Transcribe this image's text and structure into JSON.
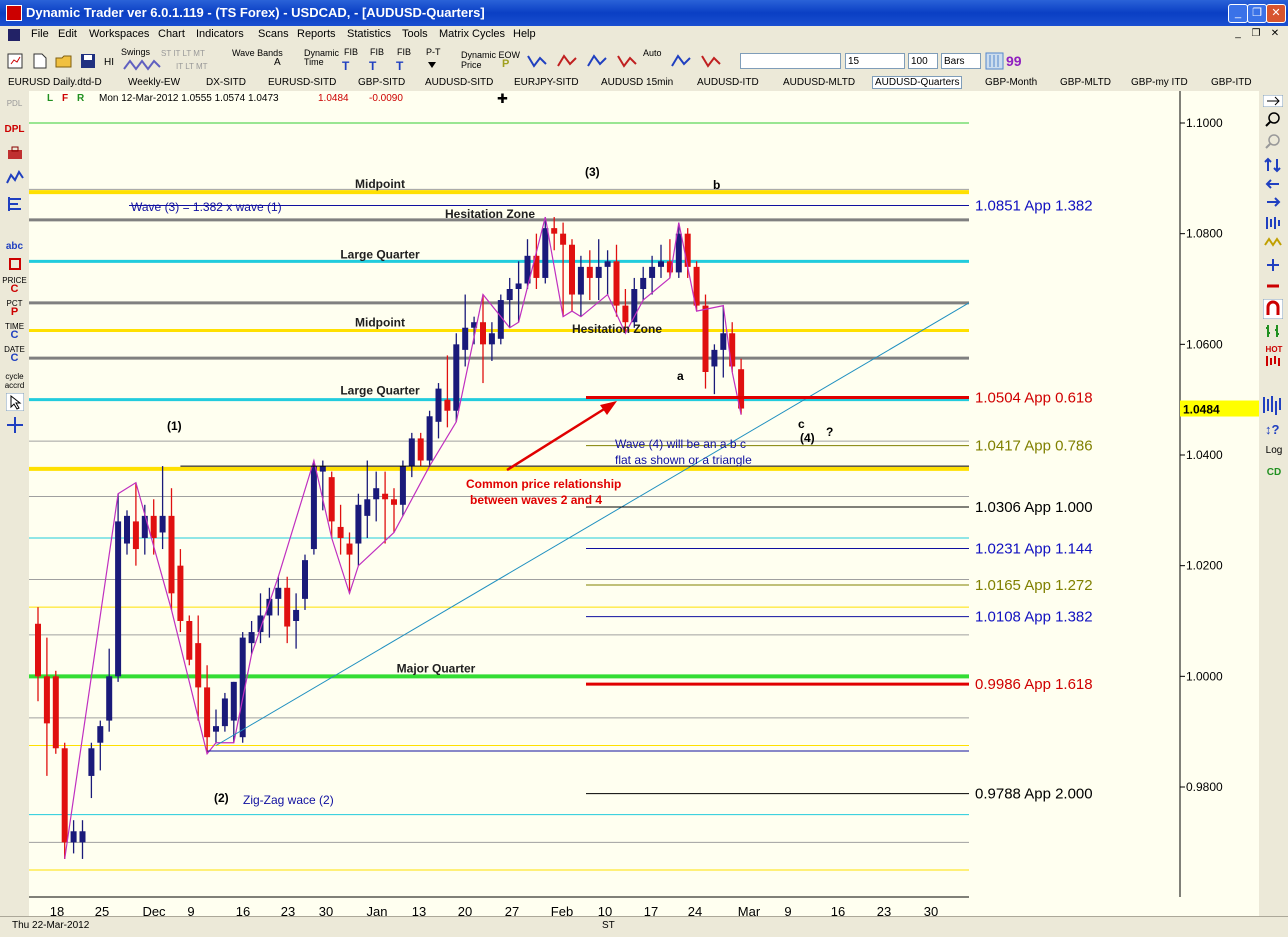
{
  "window": {
    "title": "Dynamic Trader ver 6.0.1.119 - (TS Forex) - USDCAD, - [AUDUSD-Quarters]",
    "minimize": "_",
    "restore": "❐",
    "close": "✕"
  },
  "menu": {
    "items": [
      "File",
      "Edit",
      "Workspaces",
      "Chart",
      "Indicators",
      "Scans",
      "Reports",
      "Statistics",
      "Tools",
      "Matrix Cycles",
      "Help"
    ],
    "mdi_min": "_",
    "mdi_restore": "❐",
    "mdi_close": "✕"
  },
  "toolbar": {
    "hi": "HI",
    "swings": "Swings",
    "swing_sub1": "ST IT LT MT",
    "swing_sub2": "IT LT MT",
    "wave_bands": "Wave Bands",
    "wave_a": "A",
    "dynamic_time": "Dynamic Time",
    "fib_t1": "FIB",
    "fib_t2": "FIB",
    "fib_t3": "FIB",
    "pt": "P-T",
    "dyn_eow": "Dynamic EOW",
    "dyn_price": "Price",
    "auto": "Auto",
    "combo_value": "15",
    "count_value": "100",
    "bars_value": "Bars"
  },
  "tabs": [
    "EURUSD  Daily.dtd-D",
    "Weekly-EW",
    "DX-SITD",
    "EURUSD-SITD",
    "GBP-SITD",
    "AUDUSD-SITD",
    "EURJPY-SITD",
    "AUDUSD  15min",
    "AUDUSD-ITD",
    "AUDUSD-MLTD",
    "AUDUSD-Quarters",
    "GBP-Month",
    "GBP-MLTD",
    "GBP-my ITD",
    "GBP-ITD"
  ],
  "active_tab": "AUDUSD-Quarters",
  "chart_header": {
    "pdl": "PDL",
    "flags": [
      "L",
      "F",
      "R"
    ],
    "ohlc": "Mon 12-Mar-2012   1.0555   1.0574   1.0473",
    "close": "1.0484",
    "change": "-0.0090",
    "crosshair": "✚"
  },
  "left_tools": [
    "DPL",
    "abc",
    "PRICE",
    "C",
    "PCT",
    "P",
    "TIME",
    "C",
    "DATE",
    "C",
    "cycle",
    "accrd"
  ],
  "right_tools": {
    "log": "Log",
    "cd": "CD",
    "hot": "HOT"
  },
  "status": {
    "date": "Thu 22-Mar-2012",
    "st": "ST"
  },
  "chart_data": {
    "type": "candlestick",
    "y_ticks": [
      "1.1000",
      "1.0800",
      "1.0600",
      "1.0400",
      "1.0200",
      "1.0000",
      "0.9800"
    ],
    "ylim": [
      0.965,
      1.105
    ],
    "last_price_label": "1.0484",
    "x_ticks": [
      "18",
      "25",
      "Dec",
      "9",
      "16",
      "23",
      "30",
      "Jan",
      "13",
      "20",
      "27",
      "Feb",
      "10",
      "17",
      "24",
      "Mar",
      "9",
      "16",
      "23",
      "30"
    ],
    "candles": [
      [
        1.0095,
        1.0125,
        0.9955,
        1.0
      ],
      [
        1.0,
        1.007,
        0.982,
        0.9915
      ],
      [
        1.0,
        1.001,
        0.986,
        0.987
      ],
      [
        0.987,
        0.988,
        0.967,
        0.97
      ],
      [
        0.97,
        0.974,
        0.968,
        0.972
      ],
      [
        0.97,
        0.974,
        0.967,
        0.972
      ],
      [
        0.982,
        0.988,
        0.978,
        0.987
      ],
      [
        0.988,
        0.992,
        0.983,
        0.991
      ],
      [
        0.992,
        1.005,
        0.99,
        1.0
      ],
      [
        1.0,
        1.033,
        0.999,
        1.028
      ],
      [
        1.024,
        1.03,
        1.022,
        1.029
      ],
      [
        1.028,
        1.035,
        1.02,
        1.023
      ],
      [
        1.025,
        1.031,
        1.022,
        1.029
      ],
      [
        1.029,
        1.032,
        1.022,
        1.025
      ],
      [
        1.026,
        1.038,
        1.023,
        1.029
      ],
      [
        1.029,
        1.034,
        1.012,
        1.015
      ],
      [
        1.02,
        1.023,
        1.008,
        1.01
      ],
      [
        1.01,
        1.011,
        1.002,
        1.003
      ],
      [
        1.006,
        1.011,
        0.992,
        0.998
      ],
      [
        0.998,
        1.002,
        0.986,
        0.989
      ],
      [
        0.99,
        0.994,
        0.988,
        0.991
      ],
      [
        0.991,
        0.997,
        0.99,
        0.996
      ],
      [
        0.992,
        0.999,
        0.988,
        0.999
      ],
      [
        0.989,
        1.008,
        0.988,
        1.007
      ],
      [
        1.006,
        1.01,
        1.004,
        1.008
      ],
      [
        1.008,
        1.015,
        1.006,
        1.011
      ],
      [
        1.011,
        1.016,
        1.007,
        1.014
      ],
      [
        1.014,
        1.018,
        1.011,
        1.016
      ],
      [
        1.016,
        1.018,
        1.006,
        1.009
      ],
      [
        1.01,
        1.015,
        1.005,
        1.012
      ],
      [
        1.014,
        1.022,
        1.012,
        1.021
      ],
      [
        1.023,
        1.039,
        1.022,
        1.038
      ],
      [
        1.037,
        1.039,
        1.03,
        1.038
      ],
      [
        1.036,
        1.037,
        1.025,
        1.028
      ],
      [
        1.027,
        1.031,
        1.022,
        1.025
      ],
      [
        1.024,
        1.026,
        1.015,
        1.022
      ],
      [
        1.024,
        1.033,
        1.02,
        1.031
      ],
      [
        1.029,
        1.039,
        1.025,
        1.032
      ],
      [
        1.032,
        1.037,
        1.028,
        1.034
      ],
      [
        1.033,
        1.037,
        1.024,
        1.032
      ],
      [
        1.032,
        1.034,
        1.026,
        1.031
      ],
      [
        1.031,
        1.039,
        1.029,
        1.038
      ],
      [
        1.038,
        1.044,
        1.036,
        1.043
      ],
      [
        1.043,
        1.044,
        1.038,
        1.039
      ],
      [
        1.039,
        1.048,
        1.038,
        1.047
      ],
      [
        1.046,
        1.053,
        1.043,
        1.052
      ],
      [
        1.05,
        1.058,
        1.045,
        1.048
      ],
      [
        1.048,
        1.062,
        1.046,
        1.06
      ],
      [
        1.059,
        1.069,
        1.056,
        1.063
      ],
      [
        1.063,
        1.065,
        1.06,
        1.064
      ],
      [
        1.064,
        1.069,
        1.053,
        1.06
      ],
      [
        1.06,
        1.064,
        1.057,
        1.062
      ],
      [
        1.061,
        1.069,
        1.06,
        1.068
      ],
      [
        1.068,
        1.072,
        1.063,
        1.07
      ],
      [
        1.07,
        1.075,
        1.064,
        1.071
      ],
      [
        1.071,
        1.079,
        1.07,
        1.076
      ],
      [
        1.076,
        1.08,
        1.07,
        1.072
      ],
      [
        1.072,
        1.083,
        1.071,
        1.081
      ],
      [
        1.081,
        1.083,
        1.077,
        1.08
      ],
      [
        1.08,
        1.082,
        1.065,
        1.078
      ],
      [
        1.078,
        1.079,
        1.066,
        1.069
      ],
      [
        1.069,
        1.076,
        1.065,
        1.074
      ],
      [
        1.074,
        1.077,
        1.068,
        1.072
      ],
      [
        1.072,
        1.079,
        1.068,
        1.074
      ],
      [
        1.074,
        1.077,
        1.069,
        1.075
      ],
      [
        1.075,
        1.078,
        1.065,
        1.067
      ],
      [
        1.067,
        1.07,
        1.062,
        1.064
      ],
      [
        1.064,
        1.072,
        1.063,
        1.07
      ],
      [
        1.07,
        1.074,
        1.068,
        1.072
      ],
      [
        1.072,
        1.076,
        1.069,
        1.074
      ],
      [
        1.074,
        1.078,
        1.072,
        1.075
      ],
      [
        1.075,
        1.079,
        1.072,
        1.073
      ],
      [
        1.073,
        1.082,
        1.072,
        1.08
      ],
      [
        1.08,
        1.081,
        1.072,
        1.074
      ],
      [
        1.074,
        1.075,
        1.066,
        1.067
      ],
      [
        1.067,
        1.069,
        1.052,
        1.055
      ],
      [
        1.056,
        1.06,
        1.051,
        1.059
      ],
      [
        1.059,
        1.067,
        1.054,
        1.062
      ],
      [
        1.062,
        1.064,
        1.055,
        1.056
      ],
      [
        1.0555,
        1.0574,
        1.0473,
        1.0484
      ]
    ],
    "h_levels": [
      {
        "price": 1.1,
        "color": "#33cc33",
        "width": 1
      },
      {
        "price": 1.088,
        "color": "#a0a0a0",
        "width": 1
      },
      {
        "price": 1.0875,
        "color": "#ffe000",
        "width": 4
      },
      {
        "price": 1.0825,
        "color": "#808080",
        "width": 3
      },
      {
        "price": 1.075,
        "color": "#22ccdd",
        "width": 3
      },
      {
        "price": 1.0675,
        "color": "#808080",
        "width": 3
      },
      {
        "price": 1.0625,
        "color": "#ffe000",
        "width": 3
      },
      {
        "price": 1.0575,
        "color": "#808080",
        "width": 3
      },
      {
        "price": 1.05,
        "color": "#22ccdd",
        "width": 3
      },
      {
        "price": 1.0425,
        "color": "#a0a0a0",
        "width": 1
      },
      {
        "price": 1.0375,
        "color": "#ffe000",
        "width": 4
      },
      {
        "price": 1.0325,
        "color": "#a0a0a0",
        "width": 1
      },
      {
        "price": 1.025,
        "color": "#22ccdd",
        "width": 1
      },
      {
        "price": 1.0175,
        "color": "#a0a0a0",
        "width": 1
      },
      {
        "price": 1.0125,
        "color": "#ffe000",
        "width": 1
      },
      {
        "price": 1.0075,
        "color": "#a0a0a0",
        "width": 1
      },
      {
        "price": 1.0,
        "color": "#33dd33",
        "width": 4
      },
      {
        "price": 0.9925,
        "color": "#a0a0a0",
        "width": 1
      },
      {
        "price": 0.9875,
        "color": "#ffe000",
        "width": 1
      },
      {
        "price": 0.975,
        "color": "#22ccdd",
        "width": 1
      },
      {
        "price": 0.97,
        "color": "#a0a0a0",
        "width": 1
      },
      {
        "price": 0.965,
        "color": "#ffe000",
        "width": 1
      }
    ],
    "projections": [
      {
        "price": 1.0851,
        "label": "1.0851 App 1.382",
        "color": "#1010a0",
        "width": 1,
        "textcolor": "#1010c0"
      },
      {
        "price": 1.0504,
        "label": "1.0504 App 0.618",
        "color": "#e00000",
        "width": 3,
        "textcolor": "#d00000"
      },
      {
        "price": 1.0417,
        "label": "1.0417 App 0.786",
        "color": "#808000",
        "width": 1,
        "textcolor": "#808000"
      },
      {
        "price": 1.0306,
        "label": "1.0306 App 1.000",
        "color": "#000000",
        "width": 1,
        "textcolor": "#000000"
      },
      {
        "price": 1.0231,
        "label": "1.0231 App 1.144",
        "color": "#1010a0",
        "width": 1,
        "textcolor": "#1010c0"
      },
      {
        "price": 1.0165,
        "label": "1.0165 App 1.272",
        "color": "#808000",
        "width": 1,
        "textcolor": "#808000"
      },
      {
        "price": 1.0108,
        "label": "1.0108 App 1.382",
        "color": "#1010a0",
        "width": 1,
        "textcolor": "#1010c0"
      },
      {
        "price": 0.9986,
        "label": "0.9986 App 1.618",
        "color": "#e00000",
        "width": 3,
        "textcolor": "#d00000"
      },
      {
        "price": 0.9788,
        "label": "0.9788 App 2.000",
        "color": "#000000",
        "width": 1,
        "textcolor": "#000000"
      }
    ],
    "zone_labels": [
      {
        "text": "Midpoint",
        "price": 1.0875
      },
      {
        "text": "Hesitation Zone",
        "price": 1.0825
      },
      {
        "text": "Large Quarter",
        "price": 1.075
      },
      {
        "text": "Midpoint",
        "price": 1.0625
      },
      {
        "text": "Large Quarter",
        "price": 1.05
      },
      {
        "text": "Hesitation Zone",
        "price": 1.0575
      },
      {
        "text": "Major Quarter",
        "price": 1.0
      }
    ],
    "annotations": [
      {
        "text": "Wave (3) = 1.382 x wave (1)",
        "color": "#1010a0"
      },
      {
        "text": "(3)",
        "color": "#000000"
      },
      {
        "text": "b",
        "color": "#000000"
      },
      {
        "text": "a",
        "color": "#000000"
      },
      {
        "text": "(1)",
        "color": "#000000"
      },
      {
        "text": "c",
        "color": "#000000"
      },
      {
        "text": "(4)",
        "color": "#000000"
      },
      {
        "text": "?",
        "color": "#000000"
      },
      {
        "text": "Wave (4) will be an a b c",
        "color": "#1010a0"
      },
      {
        "text": "flat as shown or a triangle",
        "color": "#1010a0"
      },
      {
        "text": "Common price relationship",
        "color": "#e00000"
      },
      {
        "text": "between waves 2 and 4",
        "color": "#e00000"
      },
      {
        "text": "(2)",
        "color": "#000000"
      },
      {
        "text": "Zig-Zag wace (2)",
        "color": "#1010a0"
      }
    ],
    "colors": {
      "up": "#1a1a7a",
      "down": "#e01010",
      "wave": "#c030c0",
      "trendline": "#2090c0",
      "background": "#fffff0"
    }
  }
}
